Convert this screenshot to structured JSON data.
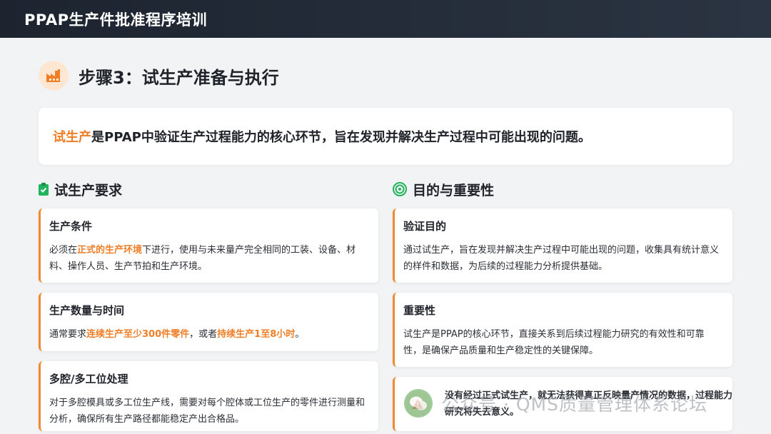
{
  "header": {
    "title": "PPAP生产件批准程序培训"
  },
  "step": {
    "icon": "factory-icon",
    "title": "步骤3：试生产准备与执行"
  },
  "intro": {
    "keyword": "试生产",
    "text": "是PPAP中验证生产过程能力的核心环节，旨在发现并解决生产过程中可能出现的问题。"
  },
  "left_section": {
    "icon": "clipboard-check-icon",
    "title": "试生产要求",
    "cards": [
      {
        "title": "生产条件",
        "text_before": "必须在",
        "highlight": "正式的生产环境",
        "text_after": "下进行，使用与未来量产完全相同的工装、设备、材料、操作人员、生产节拍和生产环境。"
      },
      {
        "title": "生产数量与时间",
        "text_before": "通常要求",
        "highlight": "连续生产至少300件零件",
        "text_mid": "，或者",
        "highlight2": "持续生产1至8小时",
        "text_after": "。"
      },
      {
        "title": "多腔/多工位处理",
        "text": "对于多腔模具或多工位生产线，需要对每个腔体或工位生产的零件进行测量和分析，确保所有生产路径都能稳定产出合格品。"
      }
    ]
  },
  "right_section": {
    "icon": "target-icon",
    "title": "目的与重要性",
    "cards": [
      {
        "title": "验证目的",
        "text": "通过试生产，旨在发现并解决生产过程中可能出现的问题，收集具有统计意义的样件和数据，为后续的过程能力分析提供基础。"
      },
      {
        "title": "重要性",
        "text": "试生产是PPAP的核心环节，直接关系到后续过程能力研究的有效性和可靠性，是确保产品质量和生产稳定性的关键保障。"
      }
    ],
    "warning": {
      "icon": "warning-icon",
      "text": "没有经过正式试生产，就无法获得真正反映量产情况的数据，过程能力研究将失去意义。"
    }
  },
  "watermark": {
    "text": "公众号 · QMS质量管理体系论坛"
  },
  "colors": {
    "accent": "#f07e26",
    "header_bg": "#1d2430",
    "check_green": "#22b35e"
  }
}
